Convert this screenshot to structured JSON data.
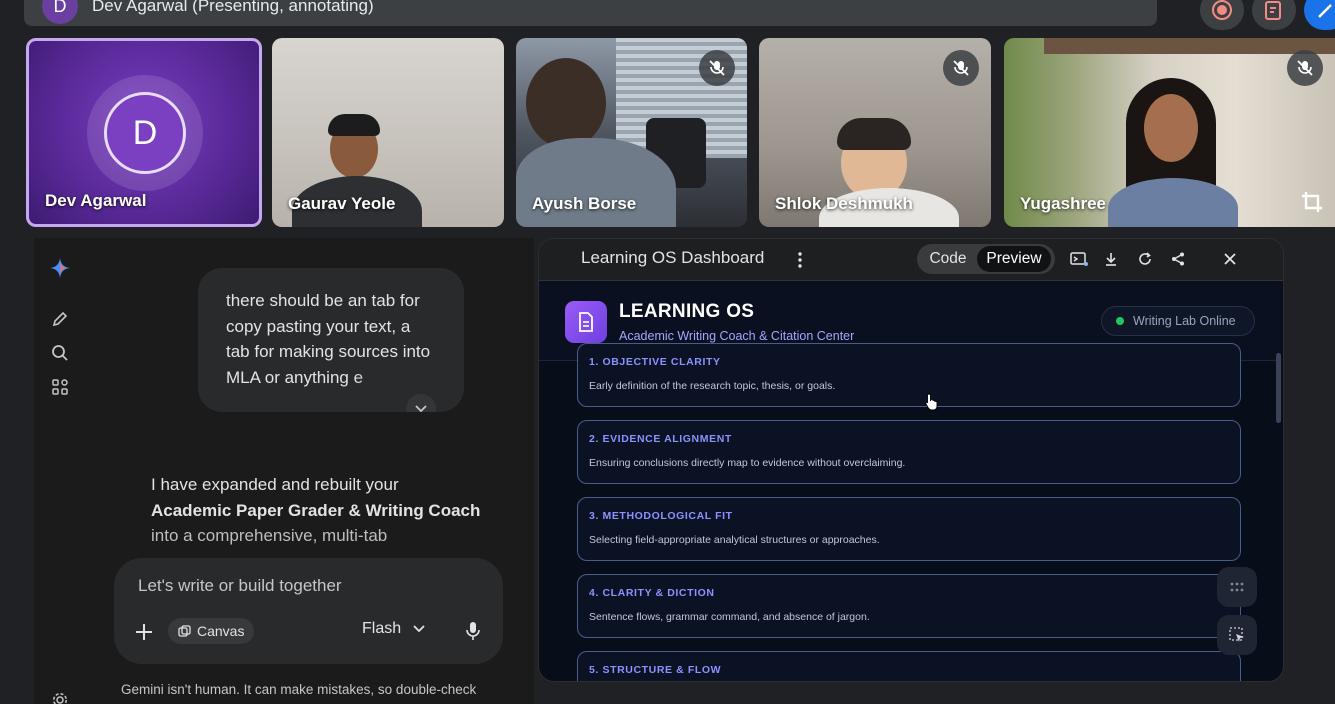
{
  "meet": {
    "presenting_avatar_initial": "D",
    "presenting_label": "Dev Agarwal (Presenting, annotating)",
    "tiles": [
      {
        "name": "Dev Agarwal",
        "initial": "D"
      },
      {
        "name": "Gaurav Yeole"
      },
      {
        "name": "Ayush Borse"
      },
      {
        "name": "Shlok Deshmukh"
      },
      {
        "name": "Yugashree"
      }
    ]
  },
  "gemini": {
    "user_message": "there should be an tab for copy pasting your text, a tab for making sources into MLA or anything e",
    "reply_prefix": "I have expanded and rebuilt your ",
    "reply_bold": "Academic Paper Grader & Writing Coach",
    "reply_suffix": " into a comprehensive, multi-tab",
    "composer_placeholder": "Let's write or build together",
    "canvas_chip": "Canvas",
    "model": "Flash",
    "disclaimer": "Gemini isn't human. It can make mistakes, so double-check"
  },
  "canvas": {
    "title": "Learning OS Dashboard",
    "code_label": "Code",
    "preview_label": "Preview",
    "accent": "#8b93ff"
  },
  "app": {
    "title": "LEARNING OS",
    "subtitle": "Academic Writing Coach & Citation Center",
    "status": "Writing Lab Online",
    "criteria": [
      {
        "title": "1. OBJECTIVE CLARITY",
        "desc": "Early definition of the research topic, thesis, or goals."
      },
      {
        "title": "2. EVIDENCE ALIGNMENT",
        "desc": "Ensuring conclusions directly map to evidence without overclaiming."
      },
      {
        "title": "3. METHODOLOGICAL FIT",
        "desc": "Selecting field-appropriate analytical structures or approaches."
      },
      {
        "title": "4. CLARITY & DICTION",
        "desc": "Sentence flows, grammar command, and absence of jargon."
      },
      {
        "title": "5. STRUCTURE & FLOW",
        "desc": ""
      }
    ]
  }
}
